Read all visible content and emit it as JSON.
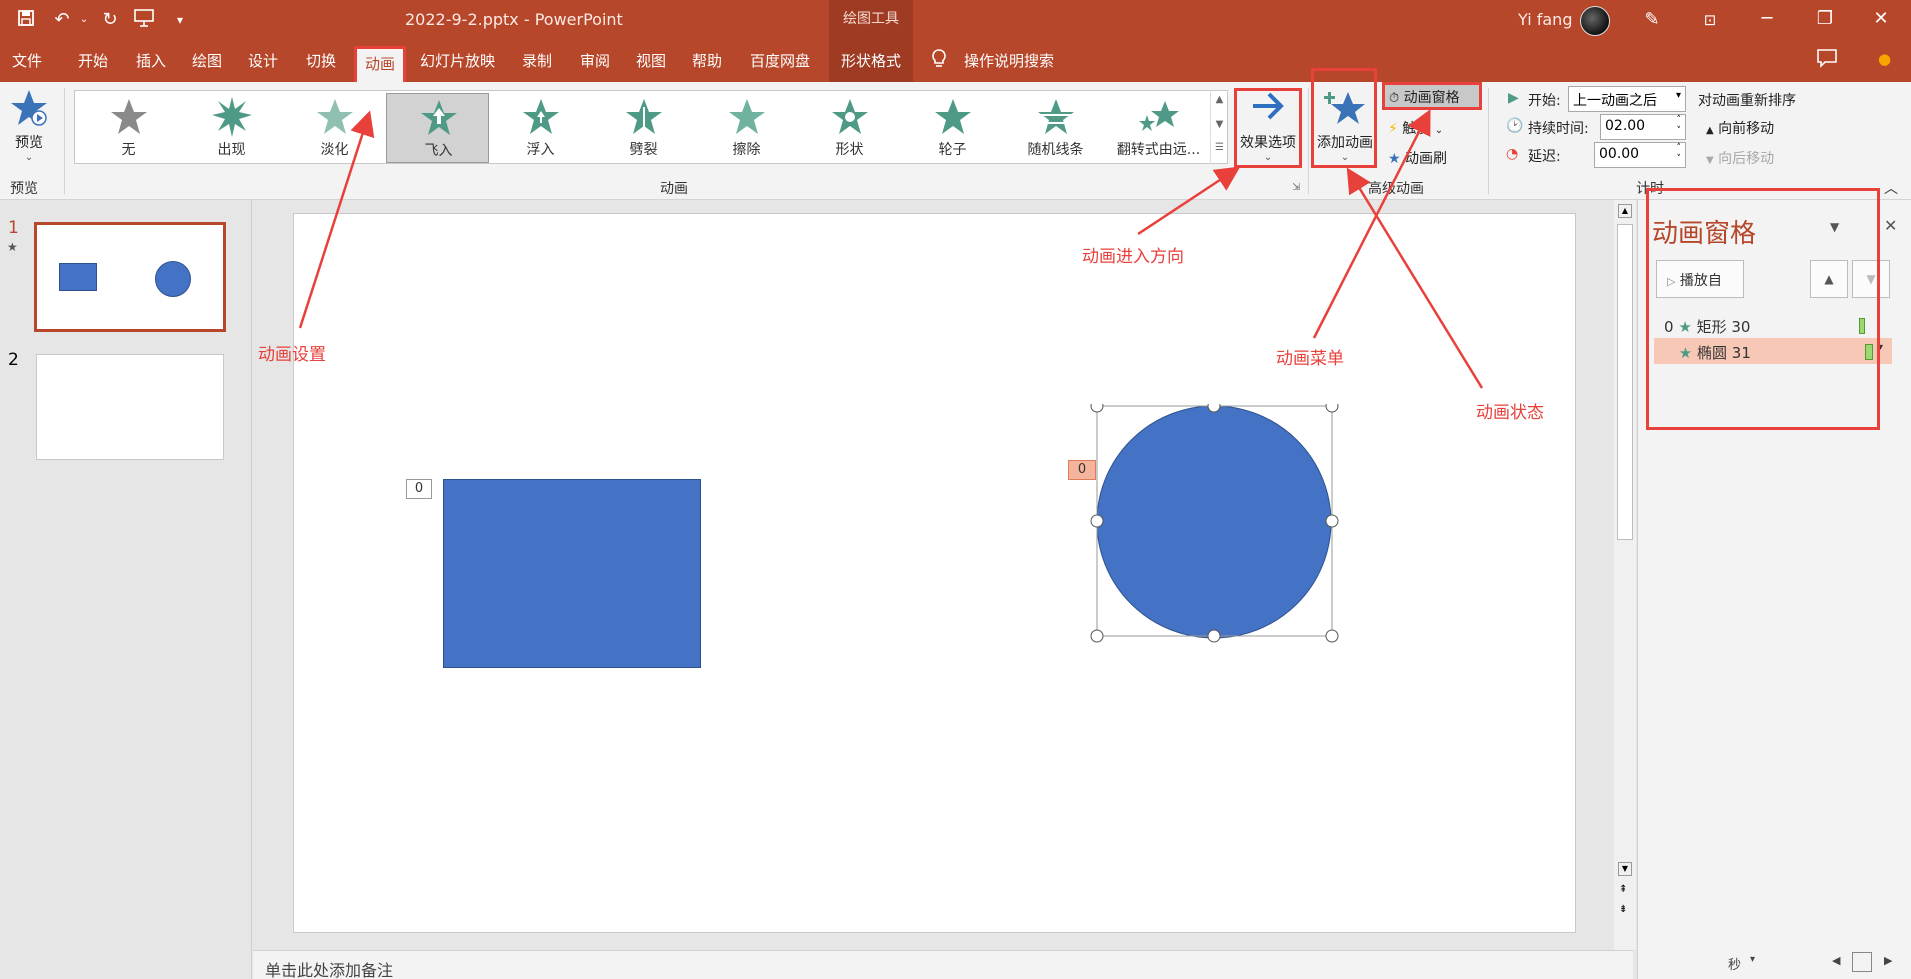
{
  "titlebar": {
    "doc_title": "2022-9-2.pptx  -  PowerPoint",
    "tools_label": "绘图工具",
    "user_name": "Yi fang",
    "minimize": "─",
    "restore": "❐",
    "close": "✕"
  },
  "menu": {
    "tabs": [
      "文件",
      "开始",
      "插入",
      "绘图",
      "设计",
      "切换",
      "动画",
      "幻灯片放映",
      "录制",
      "审阅",
      "视图",
      "帮助",
      "百度网盘",
      "形状格式"
    ],
    "search_label": "操作说明搜索"
  },
  "ribbon": {
    "preview_label": "预览",
    "preview_group": "预览",
    "animation_group": "动画",
    "advanced_group": "高级动画",
    "timing_group": "计时",
    "gallery": [
      {
        "label": "无",
        "color": "#8a8a8a"
      },
      {
        "label": "出现",
        "color": "#4f9a86"
      },
      {
        "label": "淡化",
        "color": "#8fc0b2"
      },
      {
        "label": "飞入",
        "color": "#4f9a86"
      },
      {
        "label": "浮入",
        "color": "#4f9a86"
      },
      {
        "label": "劈裂",
        "color": "#4f9a86"
      },
      {
        "label": "擦除",
        "color": "#6fb2a0"
      },
      {
        "label": "形状",
        "color": "#4f9a86"
      },
      {
        "label": "轮子",
        "color": "#4f9a86"
      },
      {
        "label": "随机线条",
        "color": "#4f9a86"
      },
      {
        "label": "翻转式由远...",
        "color": "#4f9a86"
      }
    ],
    "effect_options": "效果选项",
    "add_animation": "添加动画",
    "animation_pane": "动画窗格",
    "trigger": "触发",
    "animation_painter": "动画刷",
    "start_label": "开始:",
    "start_value": "上一动画之后",
    "duration_label": "持续时间:",
    "duration_value": "02.00",
    "delay_label": "延迟:",
    "delay_value": "00.00",
    "reorder_label": "对动画重新排序",
    "move_earlier": "向前移动",
    "move_later": "向后移动"
  },
  "thumbnails": {
    "slide1_num": "1",
    "slide1_star": "★",
    "slide2_num": "2"
  },
  "slide": {
    "rect_tag": "0",
    "circle_tag": "0",
    "shape_color": "#4472c4"
  },
  "notes": {
    "placeholder": "单击此处添加备注"
  },
  "anim_pane": {
    "title": "动画窗格",
    "play_from": "播放自",
    "items": [
      {
        "index": "0",
        "name": "矩形 30"
      },
      {
        "index": "",
        "name": "椭圆 31"
      }
    ],
    "seconds_label": "秒"
  },
  "annotations": {
    "anim_settings": "动画设置",
    "entry_direction": "动画进入方向",
    "anim_menu": "动画菜单",
    "anim_status": "动画状态"
  }
}
